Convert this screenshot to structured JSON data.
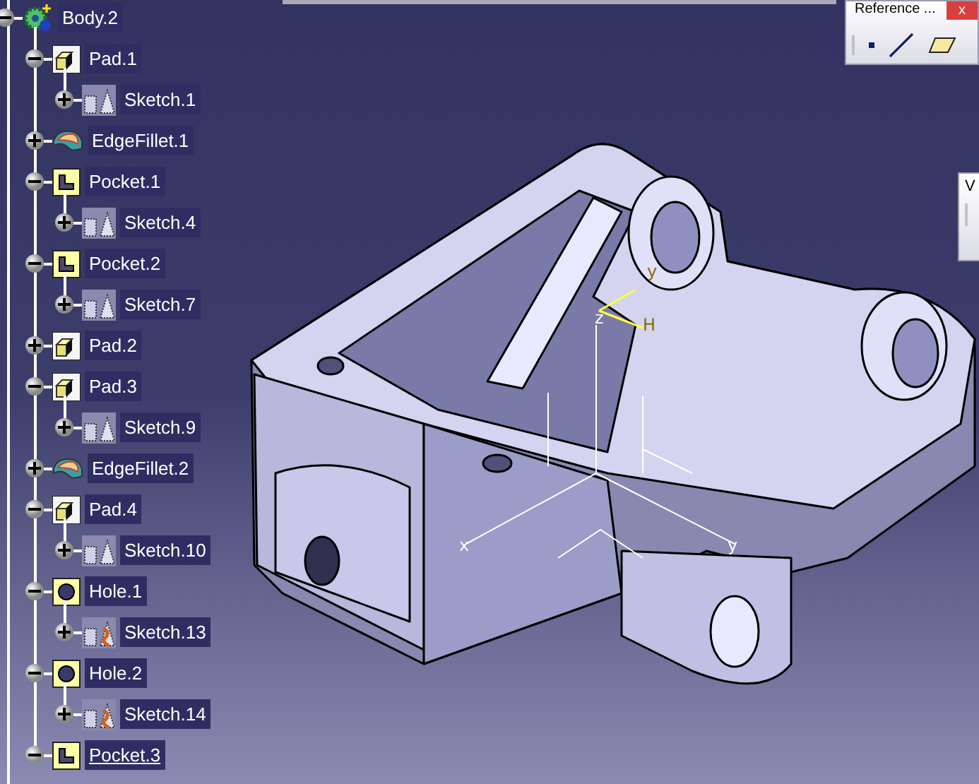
{
  "tree": {
    "label": "Body.2",
    "kind": "body",
    "expanded": true,
    "current": false,
    "children": [
      {
        "label": "Pad.1",
        "kind": "pad",
        "expanded": true,
        "current": false,
        "children": [
          {
            "label": "Sketch.1",
            "kind": "sketch",
            "expanded": false,
            "current": false
          }
        ]
      },
      {
        "label": "EdgeFillet.1",
        "kind": "fillet",
        "expanded": false,
        "current": false
      },
      {
        "label": "Pocket.1",
        "kind": "pocket",
        "expanded": true,
        "current": false,
        "children": [
          {
            "label": "Sketch.4",
            "kind": "sketch",
            "expanded": false,
            "current": false
          }
        ]
      },
      {
        "label": "Pocket.2",
        "kind": "pocket",
        "expanded": true,
        "current": false,
        "children": [
          {
            "label": "Sketch.7",
            "kind": "sketch",
            "expanded": false,
            "current": false
          }
        ]
      },
      {
        "label": "Pad.2",
        "kind": "pad",
        "expanded": false,
        "current": false
      },
      {
        "label": "Pad.3",
        "kind": "pad",
        "expanded": true,
        "current": false,
        "children": [
          {
            "label": "Sketch.9",
            "kind": "sketch",
            "expanded": false,
            "current": false
          }
        ]
      },
      {
        "label": "EdgeFillet.2",
        "kind": "fillet",
        "expanded": false,
        "current": false
      },
      {
        "label": "Pad.4",
        "kind": "pad",
        "expanded": true,
        "current": false,
        "children": [
          {
            "label": "Sketch.10",
            "kind": "sketch",
            "expanded": false,
            "current": false
          }
        ]
      },
      {
        "label": "Hole.1",
        "kind": "hole",
        "expanded": true,
        "current": false,
        "children": [
          {
            "label": "Sketch.13",
            "kind": "positioned_sketch",
            "expanded": false,
            "current": false
          }
        ]
      },
      {
        "label": "Hole.2",
        "kind": "hole",
        "expanded": true,
        "current": false,
        "children": [
          {
            "label": "Sketch.14",
            "kind": "positioned_sketch",
            "expanded": false,
            "current": false
          }
        ]
      },
      {
        "label": "Pocket.3",
        "kind": "pocket",
        "expanded": true,
        "current": true
      }
    ]
  },
  "toolbars": [
    {
      "title": "Reference ...",
      "close": "x"
    },
    {
      "title": "V"
    }
  ],
  "model": {
    "axis_labels": [
      {
        "text": "x",
        "kind": "axis"
      },
      {
        "text": "y",
        "kind": "axis"
      },
      {
        "text": "z",
        "kind": "compass"
      },
      {
        "text": "y",
        "kind": "compass"
      },
      {
        "text": "H",
        "kind": "compass"
      }
    ]
  }
}
